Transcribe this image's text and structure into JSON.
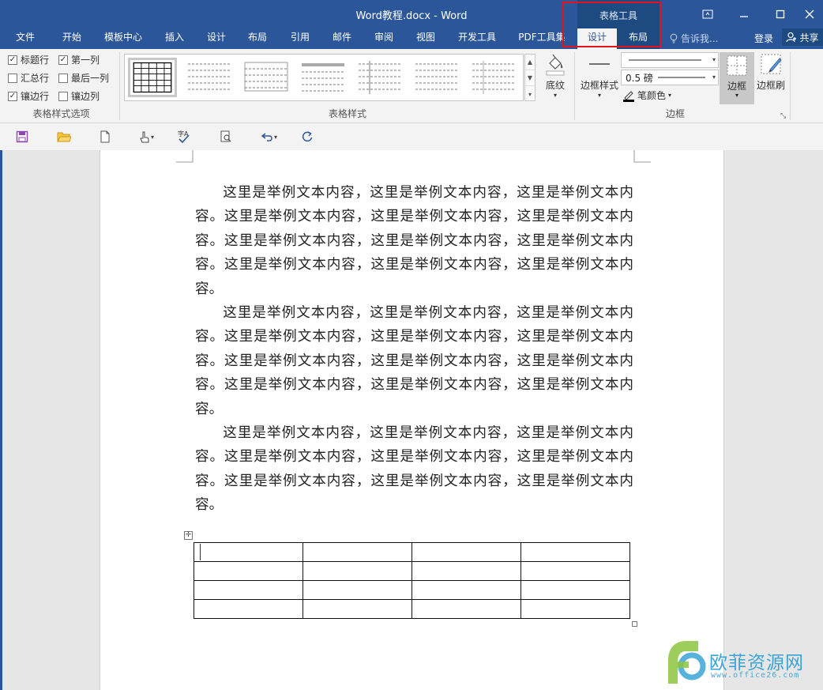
{
  "window": {
    "title": "Word教程.docx - Word",
    "context_group": "表格工具"
  },
  "tabs": [
    {
      "label": "文件"
    },
    {
      "label": "开始"
    },
    {
      "label": "模板中心"
    },
    {
      "label": "插入"
    },
    {
      "label": "设计"
    },
    {
      "label": "布局"
    },
    {
      "label": "引用"
    },
    {
      "label": "邮件"
    },
    {
      "label": "审阅"
    },
    {
      "label": "视图"
    },
    {
      "label": "开发工具"
    },
    {
      "label": "PDF工具集"
    }
  ],
  "context_tabs": [
    {
      "label": "设计",
      "active": true
    },
    {
      "label": "布局",
      "active": false
    }
  ],
  "tellme": "告诉我...",
  "login": "登录",
  "share": "共享",
  "ribbon": {
    "style_options": {
      "label": "表格样式选项",
      "checkboxes": [
        {
          "label": "标题行",
          "checked": true
        },
        {
          "label": "第一列",
          "checked": true
        },
        {
          "label": "汇总行",
          "checked": false
        },
        {
          "label": "最后一列",
          "checked": false
        },
        {
          "label": "镶边行",
          "checked": true
        },
        {
          "label": "镶边列",
          "checked": false
        }
      ]
    },
    "table_styles": {
      "label": "表格样式",
      "shading": "底纹"
    },
    "borders": {
      "label": "边框",
      "border_styles": "边框样式",
      "weight": "0.5 磅",
      "pen_color": "笔颜色",
      "borders_btn": "边框",
      "border_painter": "边框刷"
    }
  },
  "document": {
    "paragraphs": [
      "这里是举例文本内容，这里是举例文本内容，这里是举例文本内容。这里是举例文本内容，这里是举例文本内容，这里是举例文本内容。这里是举例文本内容，这里是举例文本内容，这里是举例文本内容。这里是举例文本内容，这里是举例文本内容，这里是举例文本内容。",
      "这里是举例文本内容，这里是举例文本内容，这里是举例文本内容。这里是举例文本内容，这里是举例文本内容，这里是举例文本内容。这里是举例文本内容，这里是举例文本内容，这里是举例文本内容。这里是举例文本内容，这里是举例文本内容，这里是举例文本内容。",
      "这里是举例文本内容，这里是举例文本内容，这里是举例文本内容。这里是举例文本内容，这里是举例文本内容，这里是举例文本内容。这里是举例文本内容，这里是举例文本内容，这里是举例文本内容。"
    ],
    "table": {
      "rows": 4,
      "cols": 4
    }
  },
  "watermark": {
    "name": "欧菲资源网",
    "url": "www.office26.com"
  },
  "colors": {
    "title_bar": "#2b579a",
    "context_group": "#1e4a82",
    "highlight": "#e0141e",
    "watermark": "#3aa4d6"
  }
}
